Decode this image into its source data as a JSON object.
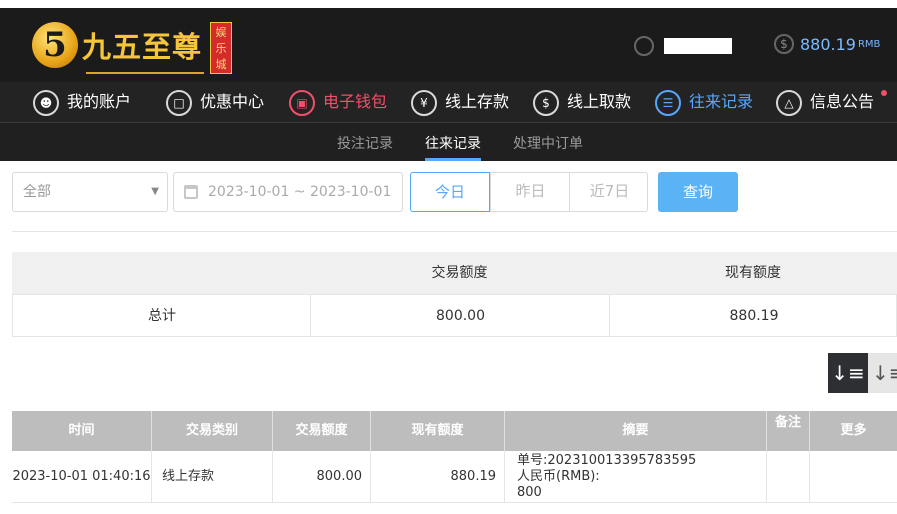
{
  "logo": {
    "glyph": "5",
    "text": "九五至尊",
    "badge": "娱乐城"
  },
  "header": {
    "balance": "880.19",
    "currency": "RMB"
  },
  "nav": [
    {
      "label": "我的账户",
      "icon": "user-icon"
    },
    {
      "label": "优惠中心",
      "icon": "gift-icon"
    },
    {
      "label": "电子钱包",
      "icon": "wallet-icon"
    },
    {
      "label": "线上存款",
      "icon": "deposit-icon"
    },
    {
      "label": "线上取款",
      "icon": "withdraw-icon"
    },
    {
      "label": "往来记录",
      "icon": "records-icon"
    },
    {
      "label": "信息公告",
      "icon": "bell-icon"
    }
  ],
  "subnav": [
    {
      "label": "投注记录"
    },
    {
      "label": "往来记录"
    },
    {
      "label": "处理中订单"
    }
  ],
  "filter": {
    "type_value": "全部",
    "date_range": "2023-10-01 ~ 2023-10-01",
    "quick": [
      "今日",
      "昨日",
      "近7日"
    ],
    "query_label": "查询"
  },
  "summary": {
    "headers": [
      "",
      "交易额度",
      "现有额度"
    ],
    "row_label": "总计",
    "amount": "800.00",
    "balance": "880.19"
  },
  "table": {
    "headers": [
      "时间",
      "交易类别",
      "交易额度",
      "现有额度",
      "摘要",
      "备注",
      "更多"
    ],
    "rows": [
      {
        "time": "2023-10-01 01:40:16",
        "category": "线上存款",
        "amount": "800.00",
        "balance": "880.19",
        "memo1": "单号:2023100133957835 95",
        "memo_line1": "单号:202310013395783595",
        "memo_line2": "人民币(RMB):",
        "memo_line3": "800",
        "note": "",
        "more": ""
      }
    ]
  },
  "colors": {
    "accent_blue": "#56a7ff",
    "accent_red": "#f34f6a",
    "header_bg": "#1b1b1b",
    "gold": "#f5c53a"
  }
}
